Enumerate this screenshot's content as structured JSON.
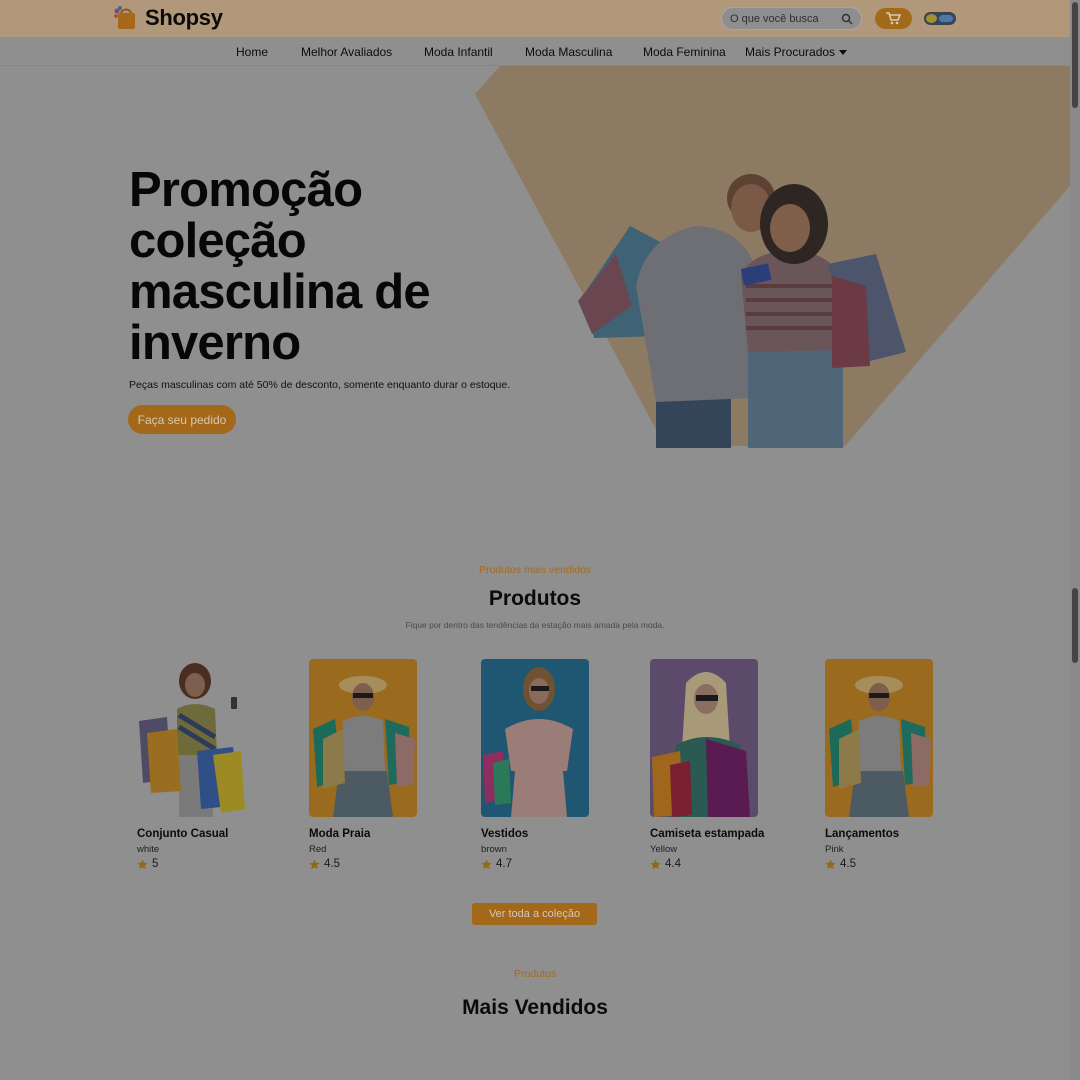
{
  "app": {
    "name": "Shopsy"
  },
  "header": {
    "search_placeholder": "O que você busca",
    "icons": {
      "logo": "shopping-bag-icon",
      "search": "search-icon",
      "cart": "cart-icon",
      "theme": "theme-toggle"
    },
    "colors": {
      "topbar": "#b2987a",
      "accent": "#a4681a"
    }
  },
  "nav": {
    "items": [
      {
        "label": "Home"
      },
      {
        "label": "Melhor Avaliados"
      },
      {
        "label": "Moda Infantil"
      },
      {
        "label": "Moda Masculina"
      },
      {
        "label": "Moda Feminina"
      },
      {
        "label": "Mais Procurados"
      }
    ]
  },
  "hero": {
    "title": "Promoção coleção masculina de inverno",
    "subtitle": "Peças masculinas com até 50% de desconto, somente enquanto durar o estoque.",
    "button": "Faça seu pedido"
  },
  "products_section": {
    "eyebrow": "Produtos mais vendidos",
    "title": "Produtos",
    "description": "Fique por dentro das tendências da estação mais amada pela moda.",
    "items": [
      {
        "name": "Conjunto Casual",
        "color": "white",
        "rating": "5"
      },
      {
        "name": "Moda Praia",
        "color": "Red",
        "rating": "4.5"
      },
      {
        "name": "Vestidos",
        "color": "brown",
        "rating": "4.7"
      },
      {
        "name": "Camiseta estampada",
        "color": "Yellow",
        "rating": "4.4"
      },
      {
        "name": "Lançamentos",
        "color": "Pink",
        "rating": "4.5"
      }
    ],
    "button": "Ver toda a coleção"
  },
  "best_sellers": {
    "eyebrow": "Produtos",
    "title": "Mais Vendidos"
  }
}
